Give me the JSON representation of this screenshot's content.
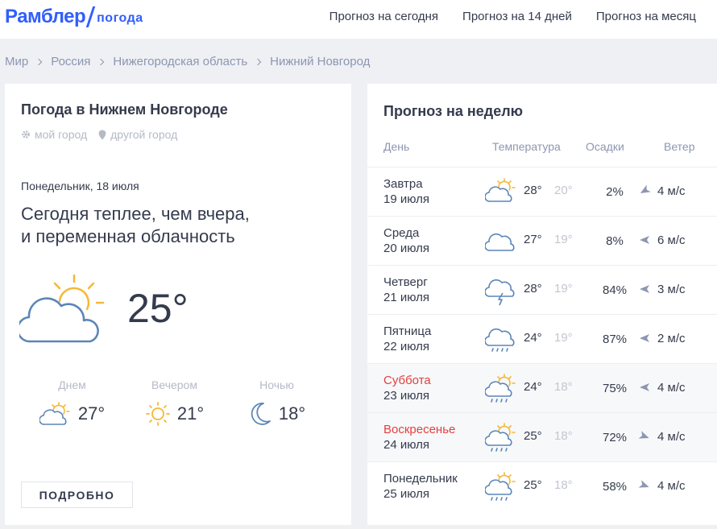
{
  "header": {
    "logo_main": "Рамблер",
    "logo_sub": "погода",
    "nav": [
      "Прогноз на сегодня",
      "Прогноз на 14 дней",
      "Прогноз на месяц"
    ]
  },
  "breadcrumb": [
    "Мир",
    "Россия",
    "Нижегородская область",
    "Нижний Новгород"
  ],
  "current": {
    "title": "Погода в Нижнем Новгороде",
    "link_my_city": "мой город",
    "link_other_city": "другой город",
    "date": "Понедельник, 18 июля",
    "summary_line1": "Сегодня теплее, чем вчера,",
    "summary_line2": "и переменная облачность",
    "icon": "partly-cloudy-icon",
    "temp": "25°",
    "parts": [
      {
        "label": "Днем",
        "temp": "27°",
        "icon": "partly-cloudy-icon"
      },
      {
        "label": "Вечером",
        "temp": "21°",
        "icon": "sun-icon"
      },
      {
        "label": "Ночью",
        "temp": "18°",
        "icon": "moon-icon"
      }
    ],
    "more_button": "ПОДРОБНО"
  },
  "week": {
    "title": "Прогноз на неделю",
    "columns": {
      "day": "День",
      "temp": "Температура",
      "precip": "Осадки",
      "wind": "Ветер"
    },
    "rows": [
      {
        "day": "Завтра",
        "date": "19 июля",
        "icon": "partly-cloudy",
        "t_day": "28°",
        "t_night": "20°",
        "precip": "2%",
        "wind": "4 м/с",
        "weekend": false
      },
      {
        "day": "Среда",
        "date": "20 июля",
        "icon": "cloudy",
        "t_day": "27°",
        "t_night": "19°",
        "precip": "8%",
        "wind": "6 м/с",
        "weekend": false
      },
      {
        "day": "Четверг",
        "date": "21 июля",
        "icon": "thunder",
        "t_day": "28°",
        "t_night": "19°",
        "precip": "84%",
        "wind": "3 м/с",
        "weekend": false
      },
      {
        "day": "Пятница",
        "date": "22 июля",
        "icon": "rain",
        "t_day": "24°",
        "t_night": "19°",
        "precip": "87%",
        "wind": "2 м/с",
        "weekend": false
      },
      {
        "day": "Суббота",
        "date": "23 июля",
        "icon": "sun-rain",
        "t_day": "24°",
        "t_night": "18°",
        "precip": "75%",
        "wind": "4 м/с",
        "weekend": true
      },
      {
        "day": "Воскресенье",
        "date": "24 июля",
        "icon": "sun-rain",
        "t_day": "25°",
        "t_night": "18°",
        "precip": "72%",
        "wind": "4 м/с",
        "weekend": true
      },
      {
        "day": "Понедельник",
        "date": "25 июля",
        "icon": "sun-rain",
        "t_day": "25°",
        "t_night": "18°",
        "precip": "58%",
        "wind": "4 м/с",
        "weekend": false
      }
    ]
  },
  "colors": {
    "brand": "#315efb",
    "weekend": "#e4403e",
    "cloud": "#5b86b8",
    "sun": "#f5b836"
  }
}
